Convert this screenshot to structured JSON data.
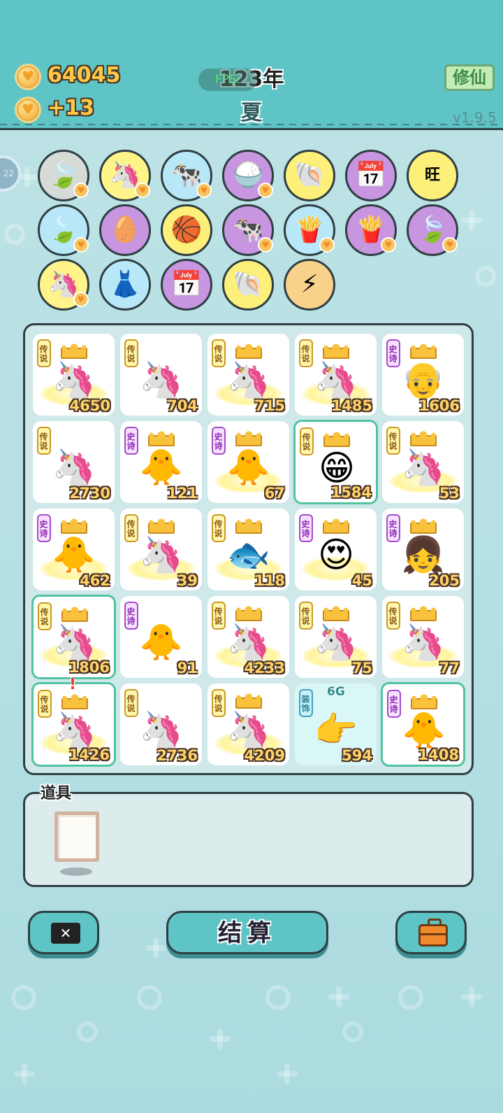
{
  "header": {
    "coins": "64045",
    "coin_income": "+13",
    "year": "123年",
    "fps_label": "FPS:",
    "season": "夏",
    "cultivate_button": "修仙",
    "version": "v1.9.5"
  },
  "side_tab": "22",
  "tray": {
    "icons": [
      {
        "name": "leaf-icon",
        "glyph": "🍃",
        "color": "c-grey",
        "heart": true
      },
      {
        "name": "unicorn-icon",
        "glyph": "🦄",
        "color": "c-yellow",
        "heart": true
      },
      {
        "name": "twin-cows-icon",
        "glyph": "🐄",
        "color": "c-blue",
        "heart": true
      },
      {
        "name": "rice-bowl-icon",
        "glyph": "🍚",
        "color": "c-purple",
        "heart": true
      },
      {
        "name": "shell-icon",
        "glyph": "🐚",
        "color": "c-lemon",
        "heart": false
      },
      {
        "name": "calendar-icon",
        "glyph": "📅",
        "color": "c-purple",
        "heart": false
      },
      {
        "name": "wang-characters-icon",
        "glyph": "旺",
        "color": "c-lemon",
        "heart": false
      },
      {
        "name": "leaf-icon",
        "glyph": "🍃",
        "color": "c-blue",
        "heart": true
      },
      {
        "name": "egg-icon",
        "glyph": "🥚",
        "color": "c-purple",
        "heart": false
      },
      {
        "name": "basketballs-icon",
        "glyph": "🏀",
        "color": "c-lemon",
        "heart": false
      },
      {
        "name": "twin-cows-icon",
        "glyph": "🐄",
        "color": "c-purple",
        "heart": true
      },
      {
        "name": "fries-icon",
        "glyph": "🍟",
        "color": "c-blue",
        "heart": true
      },
      {
        "name": "fries-icon",
        "glyph": "🍟",
        "color": "c-purple",
        "heart": true
      },
      {
        "name": "leaf-icon",
        "glyph": "🍃",
        "color": "c-purple",
        "heart": true
      },
      {
        "name": "unicorn-icon",
        "glyph": "🦄",
        "color": "c-yellow",
        "heart": true
      },
      {
        "name": "skirt-icon",
        "glyph": "👗",
        "color": "c-blue",
        "heart": false
      },
      {
        "name": "calendar-icon",
        "glyph": "📅",
        "color": "c-purple",
        "heart": false
      },
      {
        "name": "shell-icon",
        "glyph": "🐚",
        "color": "c-lemon",
        "heart": false
      },
      {
        "name": "lightning-icon",
        "glyph": "⚡",
        "color": "c-orange",
        "heart": false
      }
    ]
  },
  "board": {
    "tiles": [
      {
        "name": "unicorn-king",
        "badge": "传说",
        "badge_type": "legend",
        "face": "🦄",
        "crown": true,
        "halo": true,
        "value": "4650"
      },
      {
        "name": "unicorn",
        "badge": "传说",
        "badge_type": "legend",
        "face": "🦄",
        "crown": false,
        "halo": false,
        "value": "704"
      },
      {
        "name": "unicorn-king",
        "badge": "传说",
        "badge_type": "legend",
        "face": "🦄",
        "crown": true,
        "halo": true,
        "value": "715"
      },
      {
        "name": "unicorn-king",
        "badge": "传说",
        "badge_type": "legend",
        "face": "🦄",
        "crown": true,
        "halo": true,
        "value": "1485"
      },
      {
        "name": "old-man-king",
        "badge": "史诗",
        "badge_type": "epic",
        "face": "👴",
        "crown": true,
        "halo": false,
        "value": "1606"
      },
      {
        "name": "unicorn",
        "badge": "传说",
        "badge_type": "legend",
        "face": "🦄",
        "crown": false,
        "halo": false,
        "value": "2730"
      },
      {
        "name": "bird-king",
        "badge": "史诗",
        "badge_type": "epic",
        "face": "🐥",
        "crown": true,
        "halo": false,
        "value": "121"
      },
      {
        "name": "bird-king",
        "badge": "史诗",
        "badge_type": "epic",
        "face": "🐥",
        "crown": true,
        "halo": true,
        "value": "67"
      },
      {
        "name": "grinning-man-king",
        "badge": "传说",
        "badge_type": "legend",
        "face": "😁",
        "crown": true,
        "halo": false,
        "value": "1584",
        "selected": true
      },
      {
        "name": "unicorn-king",
        "badge": "传说",
        "badge_type": "legend",
        "face": "🦄",
        "crown": true,
        "halo": true,
        "value": "53"
      },
      {
        "name": "bird-king",
        "badge": "史诗",
        "badge_type": "epic",
        "face": "🐥",
        "crown": true,
        "halo": true,
        "value": "462"
      },
      {
        "name": "unicorn-king",
        "badge": "传说",
        "badge_type": "legend",
        "face": "🦄",
        "crown": true,
        "halo": true,
        "value": "39"
      },
      {
        "name": "koi-fish-king",
        "badge": "传说",
        "badge_type": "legend",
        "face": "🐟",
        "crown": true,
        "halo": true,
        "value": "118"
      },
      {
        "name": "heart-eyes-man-king",
        "badge": "史诗",
        "badge_type": "epic",
        "face": "😍",
        "crown": true,
        "halo": true,
        "value": "45"
      },
      {
        "name": "elf-girl-king",
        "badge": "史诗",
        "badge_type": "epic",
        "face": "👧",
        "crown": true,
        "halo": false,
        "value": "205"
      },
      {
        "name": "unicorn-king",
        "badge": "传说",
        "badge_type": "legend",
        "face": "🦄",
        "crown": true,
        "halo": true,
        "value": "1806",
        "selected": true
      },
      {
        "name": "bird",
        "badge": "史诗",
        "badge_type": "epic",
        "face": "🐥",
        "crown": false,
        "halo": false,
        "value": "91"
      },
      {
        "name": "unicorn-king",
        "badge": "传说",
        "badge_type": "legend",
        "face": "🦄",
        "crown": true,
        "halo": true,
        "value": "4233"
      },
      {
        "name": "unicorn-king",
        "badge": "传说",
        "badge_type": "legend",
        "face": "🦄",
        "crown": true,
        "halo": true,
        "value": "75"
      },
      {
        "name": "unicorn-king",
        "badge": "传说",
        "badge_type": "legend",
        "face": "🦄",
        "crown": true,
        "halo": true,
        "value": "77"
      },
      {
        "name": "unicorn-king",
        "badge": "传说",
        "badge_type": "legend",
        "face": "🦄",
        "crown": true,
        "halo": true,
        "value": "1426",
        "selected": true
      },
      {
        "name": "unicorn",
        "badge": "传说",
        "badge_type": "legend",
        "face": "🦄",
        "crown": false,
        "halo": false,
        "value": "2736"
      },
      {
        "name": "unicorn-king",
        "badge": "传说",
        "badge_type": "legend",
        "face": "🦄",
        "crown": true,
        "halo": true,
        "value": "4209"
      },
      {
        "name": "pointing-hand",
        "badge": "装饰",
        "badge_type": "deco",
        "face": "👉",
        "crown": false,
        "halo": false,
        "value": "594",
        "special": true,
        "tag": "6G"
      },
      {
        "name": "bird-king",
        "badge": "史诗",
        "badge_type": "epic",
        "face": "🐥",
        "crown": true,
        "halo": false,
        "value": "1408",
        "selected": true
      }
    ],
    "alert_mark": "!"
  },
  "props": {
    "label": "道具",
    "item": "frame-icon"
  },
  "buttons": {
    "close_glyph": "✕",
    "settle": "结算",
    "bag": "briefcase-icon"
  }
}
